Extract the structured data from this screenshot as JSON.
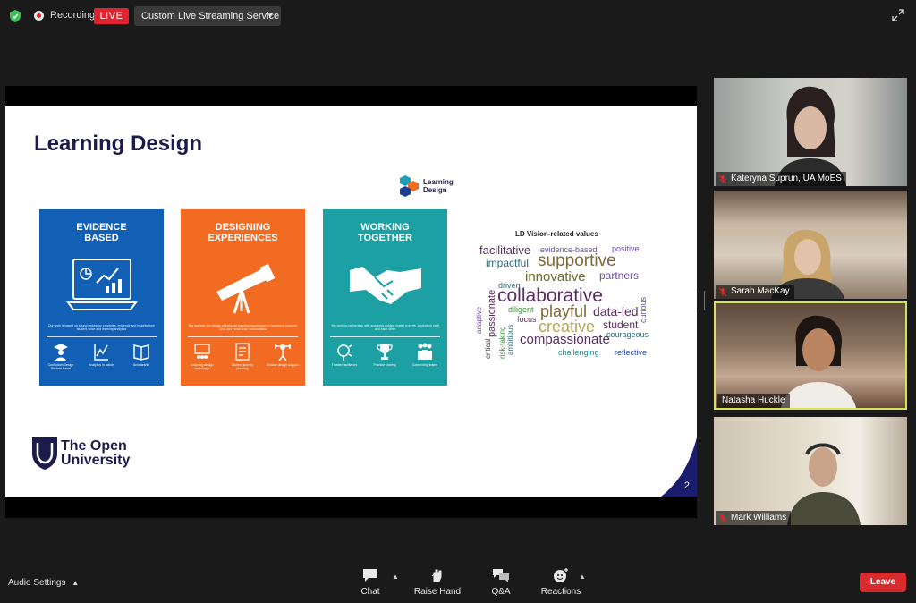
{
  "topbar": {
    "recording_label": "Recording",
    "live_label": "LIVE",
    "stream_service": "Custom Live Streaming Service",
    "colors": {
      "live": "#e0242f",
      "shield": "#3fbf5a"
    }
  },
  "slide": {
    "title": "Learning Design",
    "logo_label_line1": "Learning",
    "logo_label_line2": "Design",
    "page_number": "2",
    "panels": [
      {
        "title_line1": "EVIDENCE",
        "title_line2": "BASED",
        "icon": "laptop-chart-icon",
        "desc": "Our work is based on sound pedagogy principles, evidence and insights from student voice and learning analytics",
        "subs": [
          {
            "icon": "graduate-icon",
            "label": "Curriculum Design Student Panel"
          },
          {
            "icon": "analytics-icon",
            "label": "Analytics in action"
          },
          {
            "icon": "books-icon",
            "label": "Scholarship"
          }
        ]
      },
      {
        "title_line1": "DESIGNING",
        "title_line2": "EXPERIENCES",
        "icon": "telescope-icon",
        "desc": "We facilitate the design of inclusive learning experiences to transform students lives and enrich their communities",
        "subs": [
          {
            "icon": "workshop-icon",
            "label": "Learning design workshops"
          },
          {
            "icon": "journey-icon",
            "label": "Student journey planning"
          },
          {
            "icon": "support-icon",
            "label": "Module design support"
          }
        ]
      },
      {
        "title_line1": "WORKING",
        "title_line2": "TOGETHER",
        "icon": "handshake-icon",
        "desc": "We work in partnership with academic subject matter experts, production staff and each other",
        "subs": [
          {
            "icon": "facilitation-icon",
            "label": "Trusted facilitators"
          },
          {
            "icon": "trophy-icon",
            "label": "Practice sharing"
          },
          {
            "icon": "people-icon",
            "label": "Connecting teams"
          }
        ]
      }
    ],
    "wordcloud": {
      "title": "LD Vision-related values",
      "words": [
        "facilitative",
        "evidence-based",
        "positive",
        "impactful",
        "supportive",
        "innovative",
        "partners",
        "driven",
        "collaborative",
        "adaptive",
        "passionate",
        "curious",
        "diligent",
        "playful",
        "data-led",
        "focus",
        "critical",
        "risk-taking",
        "ambitious",
        "creative",
        "student",
        "courageous",
        "compassionate",
        "challenging",
        "reflective"
      ]
    },
    "university_line1": "The Open",
    "university_line2": "University"
  },
  "participants": [
    {
      "name": "Kateryna Suprun, UA MoES",
      "muted": true
    },
    {
      "name": "Sarah MacKay",
      "muted": true
    },
    {
      "name": "Natasha Huckle",
      "muted": false,
      "speaking": true
    },
    {
      "name": "Mark Williams",
      "muted": true
    }
  ],
  "bottombar": {
    "audio_settings": "Audio Settings",
    "chat": "Chat",
    "raise_hand": "Raise Hand",
    "qa": "Q&A",
    "reactions": "Reactions",
    "leave": "Leave",
    "leave_color": "#d92b2b"
  }
}
